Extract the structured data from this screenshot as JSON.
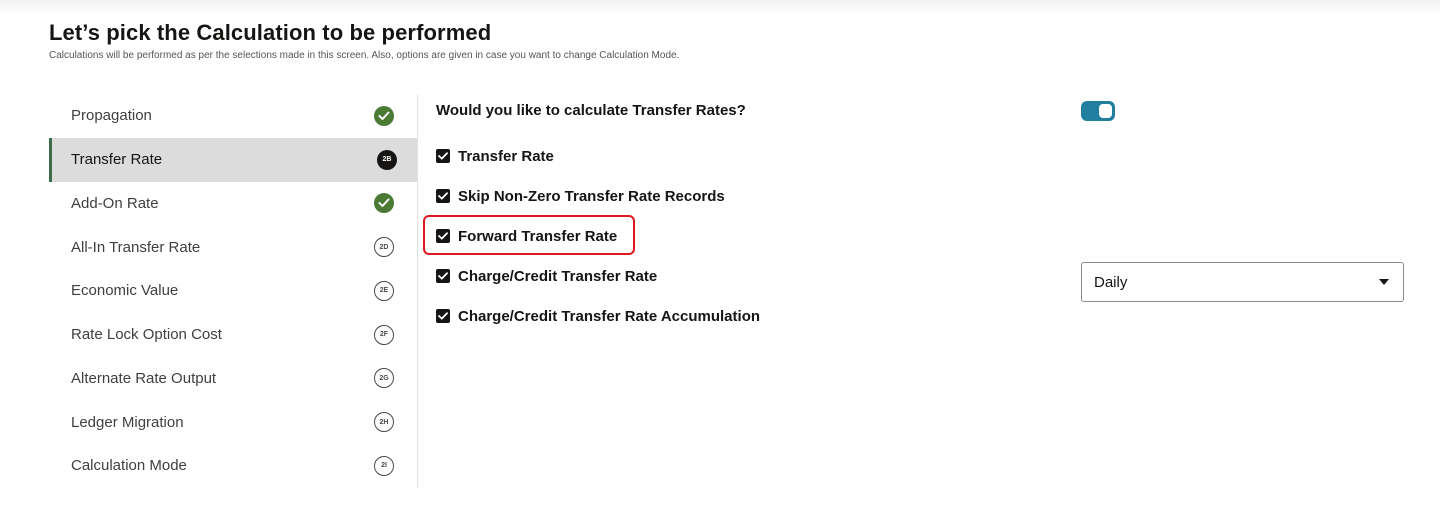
{
  "header": {
    "title": "Let’s pick the Calculation to be performed",
    "subtitle": "Calculations will be performed as per the selections made in this screen. Also, options are given in case you want to change Calculation Mode."
  },
  "sidebar": {
    "items": [
      {
        "label": "Propagation",
        "badge": "",
        "status": "done",
        "icon": "check-circle-icon"
      },
      {
        "label": "Transfer Rate",
        "badge": "2B",
        "status": "current",
        "icon": "step-badge-icon"
      },
      {
        "label": "Add-On Rate",
        "badge": "",
        "status": "done",
        "icon": "check-circle-icon"
      },
      {
        "label": "All-In Transfer Rate",
        "badge": "2D",
        "status": "pending",
        "icon": "step-badge-icon"
      },
      {
        "label": "Economic Value",
        "badge": "2E",
        "status": "pending",
        "icon": "step-badge-icon"
      },
      {
        "label": "Rate Lock Option Cost",
        "badge": "2F",
        "status": "pending",
        "icon": "step-badge-icon"
      },
      {
        "label": "Alternate Rate Output",
        "badge": "2G",
        "status": "pending",
        "icon": "step-badge-icon"
      },
      {
        "label": "Ledger Migration",
        "badge": "2H",
        "status": "pending",
        "icon": "step-badge-icon"
      },
      {
        "label": "Calculation Mode",
        "badge": "2I",
        "status": "pending",
        "icon": "step-badge-icon"
      }
    ]
  },
  "main": {
    "question": "Would you like to calculate Transfer Rates?",
    "toggle_on": true,
    "options": [
      {
        "label": "Transfer Rate",
        "checked": true
      },
      {
        "label": "Skip Non-Zero Transfer Rate Records",
        "checked": true
      },
      {
        "label": "Forward Transfer Rate",
        "checked": true,
        "highlighted": true
      },
      {
        "label": "Charge/Credit Transfer Rate",
        "checked": true
      },
      {
        "label": "Charge/Credit Transfer Rate Accumulation",
        "checked": true
      }
    ],
    "frequency_select": {
      "value": "Daily"
    }
  },
  "colors": {
    "accent": "#227e9e",
    "done": "#4a7a33",
    "active_border": "#3d6c4a",
    "highlight": "#e0191e"
  }
}
